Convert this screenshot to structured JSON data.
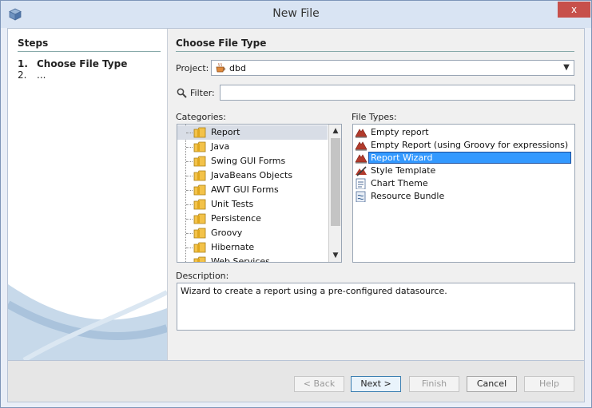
{
  "window": {
    "title": "New File",
    "close_label": "x"
  },
  "steps": {
    "title": "Steps",
    "items": [
      {
        "num": "1.",
        "label": "Choose File Type"
      },
      {
        "num": "2.",
        "label": "..."
      }
    ]
  },
  "main": {
    "title": "Choose File Type",
    "project_label": "Project:",
    "project_value": "dbd",
    "filter_label": "Filter:",
    "filter_value": "",
    "categories_label": "Categories:",
    "categories": [
      "Report",
      "Java",
      "Swing GUI Forms",
      "JavaBeans Objects",
      "AWT GUI Forms",
      "Unit Tests",
      "Persistence",
      "Groovy",
      "Hibernate",
      "Web Services"
    ],
    "file_types_label": "File Types:",
    "file_types": [
      {
        "label": "Empty report",
        "icon": "report-icon"
      },
      {
        "label": "Empty Report (using Groovy for expressions)",
        "icon": "report-icon"
      },
      {
        "label": "Report Wizard",
        "icon": "report-icon"
      },
      {
        "label": "Style Template",
        "icon": "style-icon"
      },
      {
        "label": "Chart Theme",
        "icon": "chart-theme-icon"
      },
      {
        "label": "Resource Bundle",
        "icon": "resource-bundle-icon"
      }
    ],
    "description_label": "Description:",
    "description": "Wizard to create a report using a pre-configured datasource."
  },
  "buttons": {
    "back": "< Back",
    "next": "Next >",
    "finish": "Finish",
    "cancel": "Cancel",
    "help": "Help"
  }
}
